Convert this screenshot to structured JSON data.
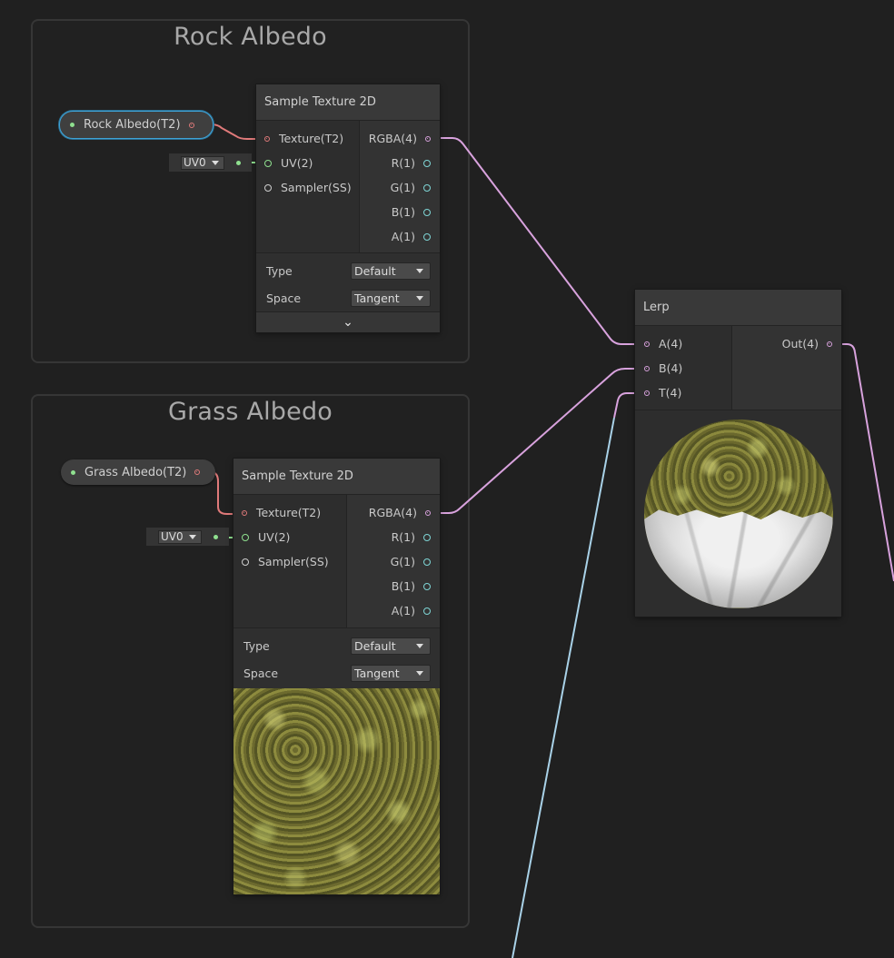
{
  "groups": {
    "rock": {
      "title": "Rock Albedo"
    },
    "grass": {
      "title": "Grass Albedo"
    }
  },
  "properties": {
    "rock": {
      "label": "Rock Albedo(T2)"
    },
    "grass": {
      "label": "Grass Albedo(T2)"
    }
  },
  "sample_node_rock": {
    "title": "Sample Texture 2D",
    "inputs": [
      "Texture(T2)",
      "UV(2)",
      "Sampler(SS)"
    ],
    "outputs": [
      "RGBA(4)",
      "R(1)",
      "G(1)",
      "B(1)",
      "A(1)"
    ],
    "settings": [
      {
        "label": "Type",
        "value": "Default"
      },
      {
        "label": "Space",
        "value": "Tangent"
      }
    ],
    "uv_value": "UV0",
    "expand_glyph": "⌄"
  },
  "sample_node_grass": {
    "title": "Sample Texture 2D",
    "inputs": [
      "Texture(T2)",
      "UV(2)",
      "Sampler(SS)"
    ],
    "outputs": [
      "RGBA(4)",
      "R(1)",
      "G(1)",
      "B(1)",
      "A(1)"
    ],
    "settings": [
      {
        "label": "Type",
        "value": "Default"
      },
      {
        "label": "Space",
        "value": "Tangent"
      }
    ],
    "uv_value": "UV0",
    "preview": "moss-texture-preview"
  },
  "lerp_node": {
    "title": "Lerp",
    "inputs": [
      "A(4)",
      "B(4)",
      "T(4)"
    ],
    "outputs": [
      "Out(4)"
    ],
    "preview": "sphere-preview"
  },
  "colors": {
    "texture_wire": "#e07a7a",
    "vector4_wire": "#d8a2dd",
    "vector2_wire": "#8fe08f",
    "float_wire": "#9fd0e8",
    "selection": "#3fa3d6"
  }
}
